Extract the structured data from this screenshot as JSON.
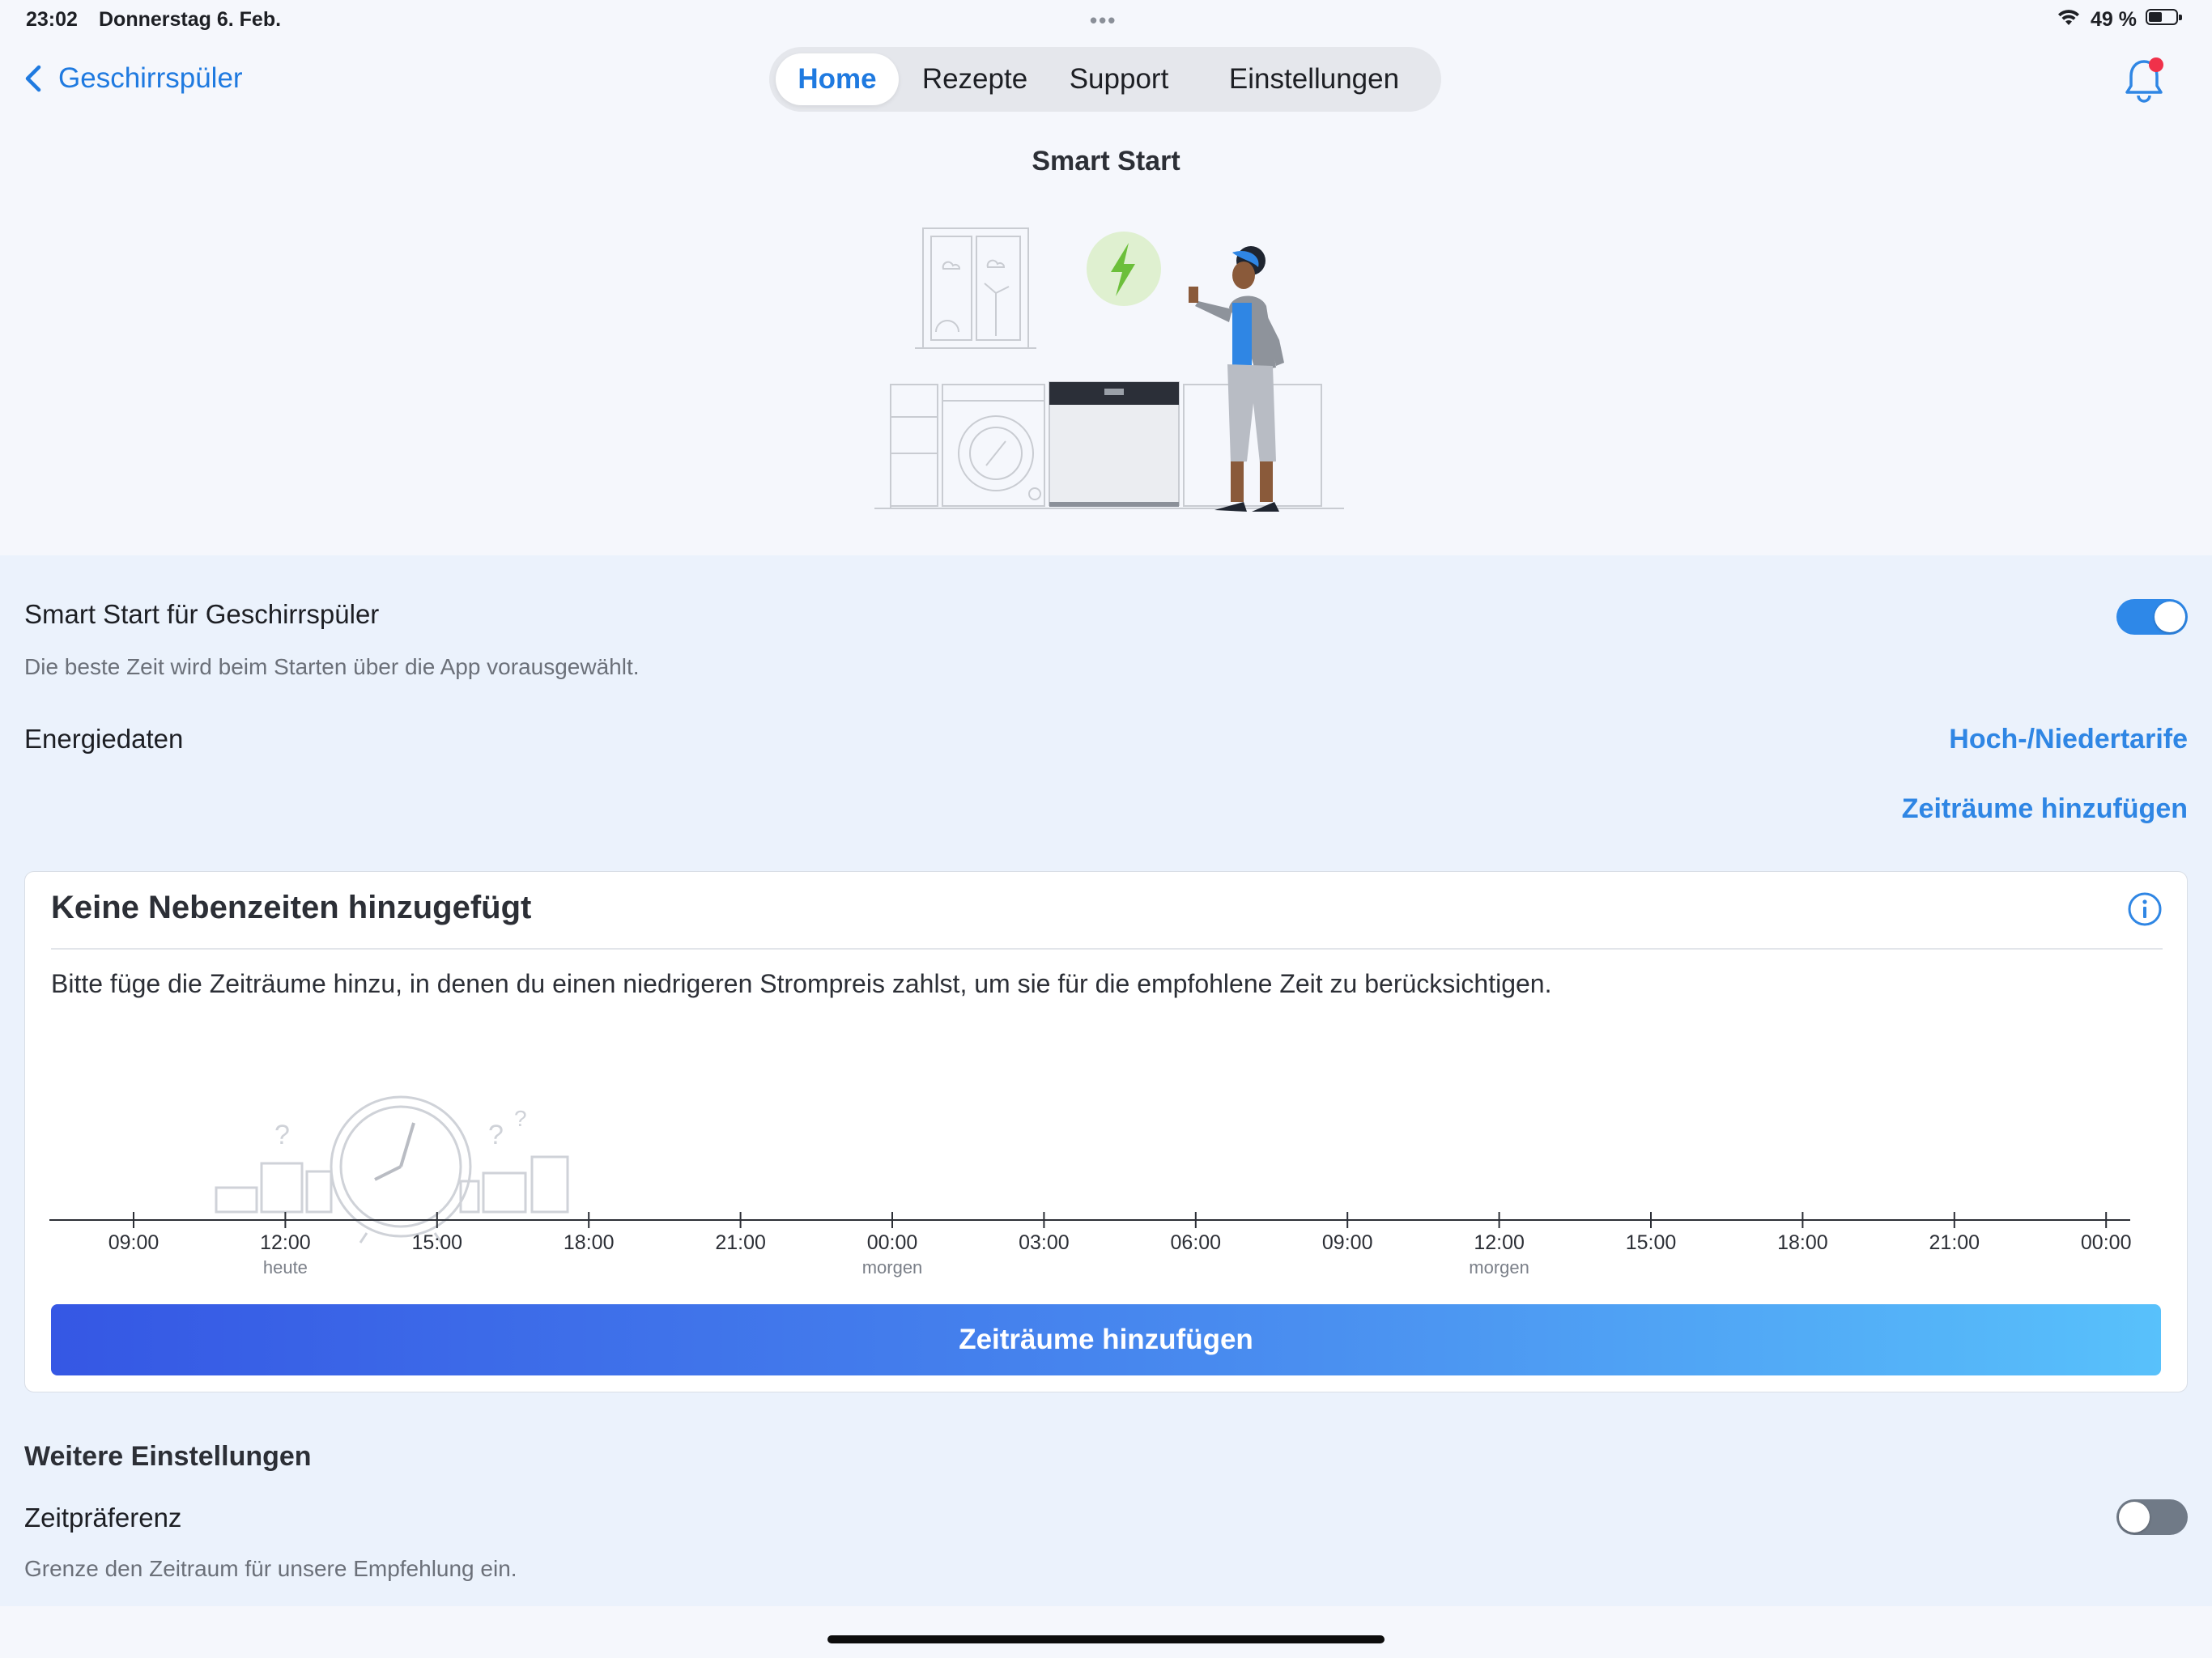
{
  "status_bar": {
    "time": "23:02",
    "date": "Donnerstag 6. Feb.",
    "multitask_dots": "•••",
    "battery": "49 %",
    "battery_level": 0.49
  },
  "nav": {
    "back_label": "Geschirrspüler",
    "tabs": [
      "Home",
      "Rezepte",
      "Support",
      "Einstellungen"
    ],
    "active_tab": "Home",
    "notification_icon": "bell-icon"
  },
  "page": {
    "title": "Smart Start"
  },
  "smart_start": {
    "label": "Smart Start für Geschirrspüler",
    "description": "Die beste Zeit wird beim Starten über die App vorausgewählt.",
    "enabled": true
  },
  "energy": {
    "label": "Energiedaten",
    "tariff_link": "Hoch-/Niedertarife",
    "add_periods_link": "Zeiträume hinzufügen"
  },
  "card": {
    "title": "Keine Nebenzeiten hinzugefügt",
    "description": "Bitte füge die Zeiträume hinzu, in denen du einen niedrigeren Strompreis zahlst, um sie für die empfohlene Zeit zu berücksichtigen.",
    "timeline": {
      "ticks": [
        "09:00",
        "12:00",
        "15:00",
        "18:00",
        "21:00",
        "00:00",
        "03:00",
        "06:00",
        "09:00",
        "12:00",
        "15:00",
        "18:00",
        "21:00",
        "00:00"
      ],
      "sublabels": [
        "",
        "heute",
        "",
        "",
        "",
        "morgen",
        "",
        "",
        "",
        "morgen",
        "",
        "",
        "",
        ""
      ]
    },
    "cta_label": "Zeiträume hinzufügen"
  },
  "more_settings": {
    "title": "Weitere Einstellungen",
    "time_pref_label": "Zeitpräferenz",
    "time_pref_description": "Grenze den Zeitraum für unsere Empfehlung ein.",
    "time_pref_enabled": false
  },
  "colors": {
    "accent": "#1f7ae0",
    "toggle_on": "#2e88e8",
    "toggle_off": "#707a87",
    "cta_start": "#3557e4",
    "cta_end": "#58c1fb",
    "badge": "#f0314a"
  }
}
